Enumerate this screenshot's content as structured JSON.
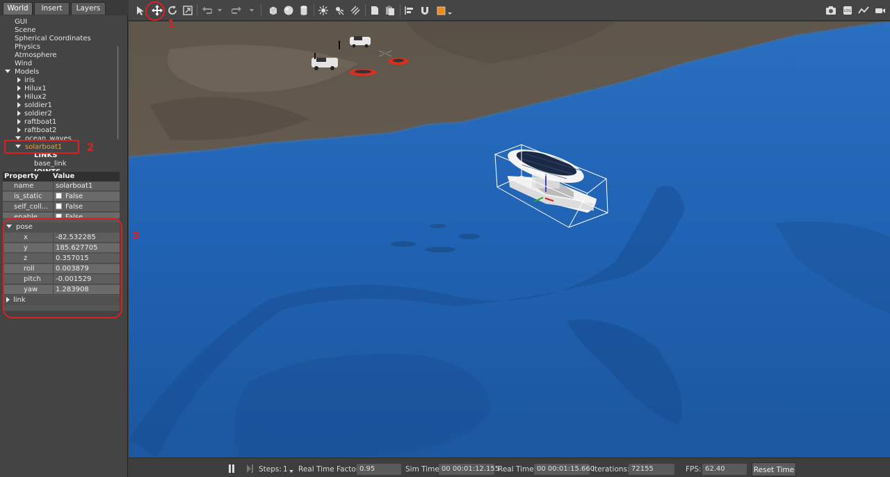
{
  "tabs": [
    {
      "label": "World"
    },
    {
      "label": "Insert"
    },
    {
      "label": "Layers"
    }
  ],
  "tree": {
    "items": [
      {
        "label": "GUI"
      },
      {
        "label": "Scene"
      },
      {
        "label": "Spherical Coordinates"
      },
      {
        "label": "Physics"
      },
      {
        "label": "Atmosphere"
      },
      {
        "label": "Wind"
      },
      {
        "label": "Models"
      },
      {
        "label": "iris"
      },
      {
        "label": "Hilux1"
      },
      {
        "label": "Hilux2"
      },
      {
        "label": "soldier1"
      },
      {
        "label": "soldier2"
      },
      {
        "label": "raftboat1"
      },
      {
        "label": "raftboat2"
      },
      {
        "label": "ocean_waves"
      },
      {
        "label": "solarboat1"
      },
      {
        "label": "LINKS"
      },
      {
        "label": "base_link"
      },
      {
        "label": "JOINTS"
      }
    ]
  },
  "properties": {
    "header": {
      "property": "Property",
      "value": "Value"
    },
    "name": {
      "key": "name",
      "value": "solarboat1"
    },
    "is_static": {
      "key": "is_static",
      "value": "False"
    },
    "self_collide": {
      "key": "self_coll...",
      "value": "False"
    },
    "enable_wind": {
      "key": "enable_...",
      "value": "False"
    },
    "pose_label": "pose",
    "pose": [
      {
        "key": "x",
        "value": "-82.532285"
      },
      {
        "key": "y",
        "value": "185.627705"
      },
      {
        "key": "z",
        "value": "0.357015"
      },
      {
        "key": "roll",
        "value": "0.003879"
      },
      {
        "key": "pitch",
        "value": "-0.001529"
      },
      {
        "key": "yaw",
        "value": "1.283908"
      }
    ],
    "link_label": "link"
  },
  "annotations": {
    "one": "1",
    "two": "2",
    "three": "3"
  },
  "bottom_bar": {
    "steps_label": "Steps:",
    "steps_value": "1",
    "rtf_label": "Real Time Factor:",
    "rtf_value": "0.95",
    "sim_time_label": "Sim Time:",
    "sim_time_value": "00 00:01:12.155",
    "real_time_label": "Real Time:",
    "real_time_value": "00 00:01:15.660",
    "iterations_label": "Iterations:",
    "iterations_value": "72155",
    "fps_label": "FPS:",
    "fps_value": "62.40",
    "reset_label": "Reset Time"
  },
  "colors": {
    "annotation": "#e02020",
    "selected_text": "#e8a03a",
    "water": "#1f5fa8",
    "terrain": "#6b5f52"
  }
}
